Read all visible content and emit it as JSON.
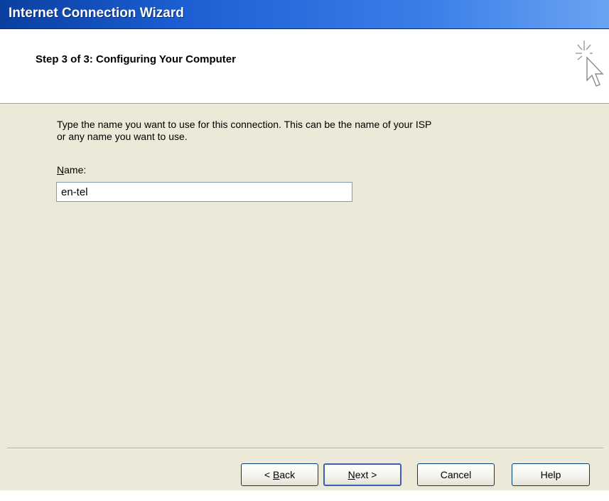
{
  "window": {
    "title": "Internet Connection Wizard"
  },
  "header": {
    "step_title": "Step 3 of 3: Configuring Your Computer",
    "icon": "wizard-cursor-sparkle-icon"
  },
  "body": {
    "instruction_line1": "Type the name you want to use for this connection. This can be the name of your ISP",
    "instruction_line2": "or any name you want to use.",
    "name_label_mnemonic": "N",
    "name_label_rest": "ame:",
    "name_value": "en-tel"
  },
  "buttons": {
    "back_prefix": "< ",
    "back_mnemonic": "B",
    "back_rest": "ack",
    "next_mnemonic": "N",
    "next_rest": "ext >",
    "cancel": "Cancel",
    "help": "Help"
  },
  "colors": {
    "titlebar": "#1b5fd3",
    "dialog_bg": "#ece9d8",
    "header_bg": "#ffffff"
  }
}
